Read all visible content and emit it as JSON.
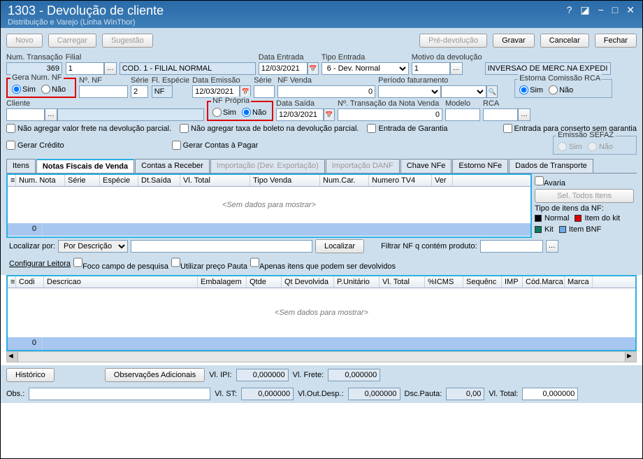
{
  "window": {
    "title": "1303 - Devolução de cliente",
    "subtitle": "Distribuição e Varejo (Linha WinThor)"
  },
  "toolbar": {
    "novo": "Novo",
    "carregar": "Carregar",
    "sugestao": "Sugestão",
    "pre": "Pré-devolução",
    "gravar": "Gravar",
    "cancelar": "Cancelar",
    "fechar": "Fechar"
  },
  "labels": {
    "num_transacao": "Num. Transação",
    "filial": "Filial",
    "cod_filial": "COD. 1 - FILIAL NORMAL",
    "data_entrada": "Data Entrada",
    "tipo_entrada": "Tipo Entrada",
    "motivo": "Motivo da devolução",
    "motivo_desc": "INVERSAO DE MERC.NA EXPEDICAO",
    "gera_num_nf": "Gera Num. NF",
    "no_nf": "Nº. NF",
    "serie": "Série",
    "fl_especie": "Fl. Espécie",
    "data_emissao": "Data Emissão",
    "serie2": "Série",
    "nf_venda": "NF Venda",
    "periodo_fat": "Período faturamento",
    "estorna": "Estorna Comissão RCA",
    "cliente": "Cliente",
    "nf_propria": "NF Própria",
    "data_saida": "Data Saída",
    "no_trans_venda": "Nº. Transação da Nota Venda",
    "modelo": "Modelo",
    "rca": "RCA",
    "sim": "Sim",
    "nao": "Não",
    "chk_frete": "Não agregar valor frete na devolução parcial.",
    "chk_boleto": "Não agregar taxa de boleto na devolução parcial.",
    "chk_garantia": "Entrada de Garantia",
    "chk_conserto": "Entrada para conserto sem garantia",
    "gerar_credito": "Gerar Crédito",
    "gerar_contas": "Gerar Contas à Pagar",
    "emissao_sefaz": "Emissão SEFAZ",
    "avaria": "Avaria",
    "sel_todos": "Sel. Todos Itens",
    "tipo_itens": "Tipo de itens da NF:",
    "leg_normal": "Normal",
    "leg_kit": "Kit",
    "leg_item_kit": "Item do kit",
    "leg_item_bnf": "Item BNF",
    "localizar_por": "Localizar por:",
    "por_desc": "Por Descrição",
    "localizar": "Localizar",
    "filtrar_nf": "Filtrar NF q contém produto:",
    "config_leitora": "Configurar Leitora",
    "foco": "Foco campo de pesquisa",
    "preco_pauta": "Utilizar preço Pauta",
    "apenas_devolv": "Apenas itens que podem ser devolvidos",
    "sem_dados": "<Sem dados para mostrar>",
    "historico": "Histórico",
    "obs_adic": "Observações Adicionais",
    "obs": "Obs.:",
    "vl_ipi": "Vl. IPI:",
    "vl_st": "Vl. ST:",
    "vl_frete": "Vl. Frete:",
    "vl_out": "Vl.Out.Desp.:",
    "dsc_pauta": "Dsc.Pauta:",
    "vl_total": "Vl. Total:"
  },
  "values": {
    "num_transacao": "369",
    "filial": "1",
    "data_entrada": "12/03/2021",
    "tipo_entrada": "6 - Dev. Normal",
    "motivo": "1",
    "serie_fl": "2",
    "especie": "NF",
    "data_emissao": "12/03/2021",
    "nf_venda": "0",
    "data_saida": "12/03/2021",
    "no_trans_venda": "0",
    "zero": "0",
    "vl_ipi": "0,000000",
    "vl_st": "0,000000",
    "vl_frete": "0,000000",
    "vl_out": "0,000000",
    "dsc_pauta": "0,00",
    "vl_total": "0,000000"
  },
  "tabs": [
    "Itens",
    "Notas Fiscais de Venda",
    "Contas a Receber",
    "Importação (Dev. Exportação)",
    "Importação DANF",
    "Chave NFe",
    "Estorno NFe",
    "Dados de Transporte"
  ],
  "grid1_cols": [
    "Num. Nota",
    "Série",
    "Espécie",
    "Dt.Saída",
    "Vl. Total",
    "Tipo Venda",
    "Num.Car.",
    "Numero TV4",
    "Ver"
  ],
  "grid2_cols": [
    "Codi",
    "Descricao",
    "Embalagem",
    "Qtde",
    "Qt Devolvida",
    "P.Unitário",
    "Vl. Total",
    "%ICMS",
    "Sequênc",
    "IMP",
    "Cód.Marca",
    "Marca"
  ]
}
